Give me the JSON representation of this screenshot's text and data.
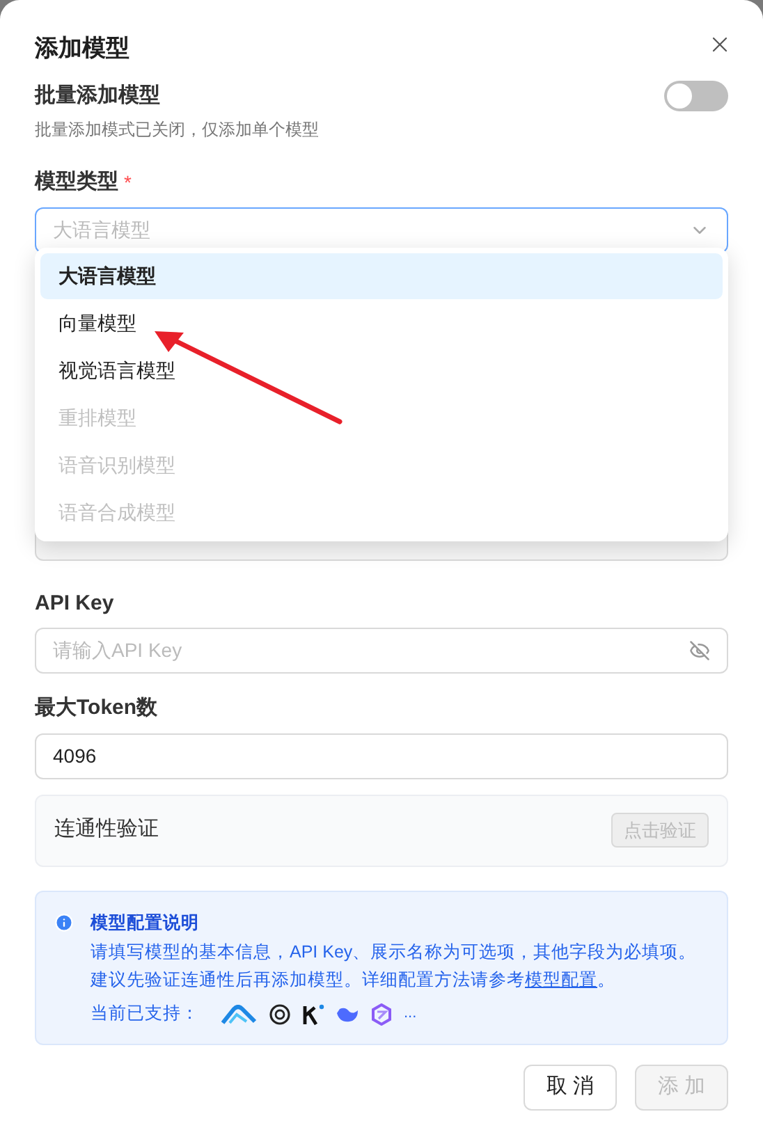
{
  "dialog": {
    "title": "添加模型"
  },
  "batch": {
    "label": "批量添加模型",
    "on": false,
    "hint": "批量添加模式已关闭，仅添加单个模型"
  },
  "model_type": {
    "label": "模型类型",
    "required_mark": "*",
    "placeholder": "大语言模型",
    "expanded": true
  },
  "dropdown": {
    "options": [
      {
        "label": "大语言模型",
        "selected": true,
        "disabled": false
      },
      {
        "label": "向量模型",
        "selected": false,
        "disabled": false
      },
      {
        "label": "视觉语言模型",
        "selected": false,
        "disabled": false
      },
      {
        "label": "重排模型",
        "selected": false,
        "disabled": true
      },
      {
        "label": "语音识别模型",
        "selected": false,
        "disabled": true
      },
      {
        "label": "语音合成模型",
        "selected": false,
        "disabled": true
      }
    ]
  },
  "api_key": {
    "label": "API Key",
    "placeholder": "请输入API Key"
  },
  "max_tokens": {
    "label": "最大Token数",
    "value": "4096"
  },
  "connectivity": {
    "label": "连通性验证",
    "button": "点击验证",
    "disabled": true
  },
  "info": {
    "title": "模型配置说明",
    "text": "请填写模型的基本信息，API Key、展示名称为可选项，其他字段为必填项。建议先验证连通性后再添加模型。详细配置方法请参考",
    "link": "模型配置",
    "text_end": "。",
    "supported_label": "当前已支持：",
    "more": "..."
  },
  "buttons": [
    {
      "label": "取 消",
      "kind": "secondary",
      "disabled": false
    },
    {
      "label": "添 加",
      "kind": "primary",
      "disabled": true
    }
  ]
}
